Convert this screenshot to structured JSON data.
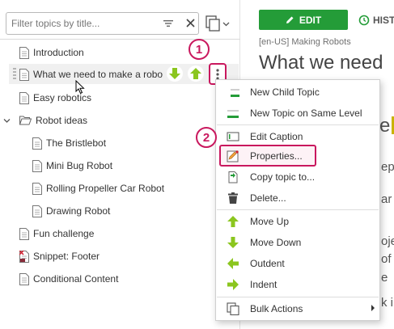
{
  "filter": {
    "placeholder": "Filter topics by title...",
    "value": ""
  },
  "tree": {
    "items": [
      {
        "label": "Introduction",
        "icon": "document-icon"
      },
      {
        "label": "What we need to make a robo",
        "icon": "document-icon",
        "selected": true
      },
      {
        "label": "Easy robotics",
        "icon": "document-icon"
      },
      {
        "label": "Robot ideas",
        "icon": "folder-open-icon",
        "expanded": true
      },
      {
        "label": "The Bristlebot",
        "icon": "document-icon"
      },
      {
        "label": "Mini Bug Robot",
        "icon": "document-icon"
      },
      {
        "label": "Rolling Propeller Car Robot",
        "icon": "document-icon"
      },
      {
        "label": "Drawing Robot",
        "icon": "document-icon"
      },
      {
        "label": "Fun challenge",
        "icon": "document-icon"
      },
      {
        "label": "Snippet: Footer",
        "icon": "snippet-icon"
      },
      {
        "label": "Conditional Content",
        "icon": "document-icon"
      }
    ]
  },
  "callouts": {
    "first": "1",
    "second": "2"
  },
  "toolbar": {
    "edit_label": "EDIT",
    "history_label": "HIST"
  },
  "page": {
    "breadcrumb": "[en-US] Making Robots",
    "title": "What we need",
    "fragments": [
      "e",
      "ep",
      "ar",
      "oje",
      "of t",
      "e",
      "k i"
    ]
  },
  "menu": {
    "items": [
      {
        "label": "New Child Topic",
        "icon": "new-child-topic-icon"
      },
      {
        "label": "New Topic on Same Level",
        "icon": "new-sibling-topic-icon"
      },
      {
        "label": "Edit Caption",
        "icon": "caption-icon"
      },
      {
        "label": "Properties...",
        "icon": "properties-icon",
        "highlighted": true
      },
      {
        "label": "Copy topic to...",
        "icon": "copy-topic-icon"
      },
      {
        "label": "Delete...",
        "icon": "trash-icon"
      },
      {
        "label": "Move Up",
        "icon": "arrow-up-icon"
      },
      {
        "label": "Move Down",
        "icon": "arrow-down-icon"
      },
      {
        "label": "Outdent",
        "icon": "arrow-left-icon"
      },
      {
        "label": "Indent",
        "icon": "arrow-right-icon"
      },
      {
        "label": "Bulk Actions",
        "icon": "copy-pages-icon",
        "has_submenu": true
      }
    ]
  },
  "colors": {
    "accent_green": "#249c38",
    "arrow_green": "#8bc61f",
    "highlight_pink": "#c9185e"
  }
}
